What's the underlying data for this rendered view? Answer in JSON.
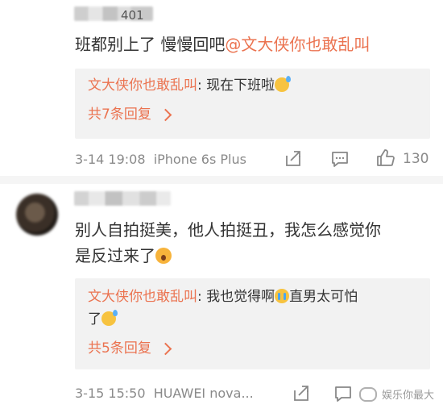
{
  "comment1": {
    "time_partial": "401",
    "text_prefix": "班都别上了 慢慢回吧",
    "mention": "@文大侠你也敢乱叫",
    "reply": {
      "user": "文大侠你也敢乱叫",
      "text": ": 现在下班啦"
    },
    "more_replies": "共7条回复",
    "timestamp": "3-14 19:08",
    "device": "iPhone 6s Plus",
    "likes": "130"
  },
  "comment2": {
    "text_line1": "别人自拍挺美，他人拍挺丑，我怎么感觉你",
    "text_line2": "是反过来了",
    "reply": {
      "user": "文大侠你也敢乱叫",
      "text_a": ": 我也觉得啊",
      "text_b": "直男太可怕",
      "text_c": "了"
    },
    "more_replies": "共5条回复",
    "timestamp": "3-15 15:50",
    "device": "HUAWEI nova...",
    "watermark": "娱乐你最大"
  },
  "colors": {
    "accent": "#eb7350",
    "meta": "#8a8a8a",
    "reply_bg": "#f2f2f2"
  },
  "icons": [
    "share-icon",
    "comment-icon",
    "like-icon"
  ]
}
